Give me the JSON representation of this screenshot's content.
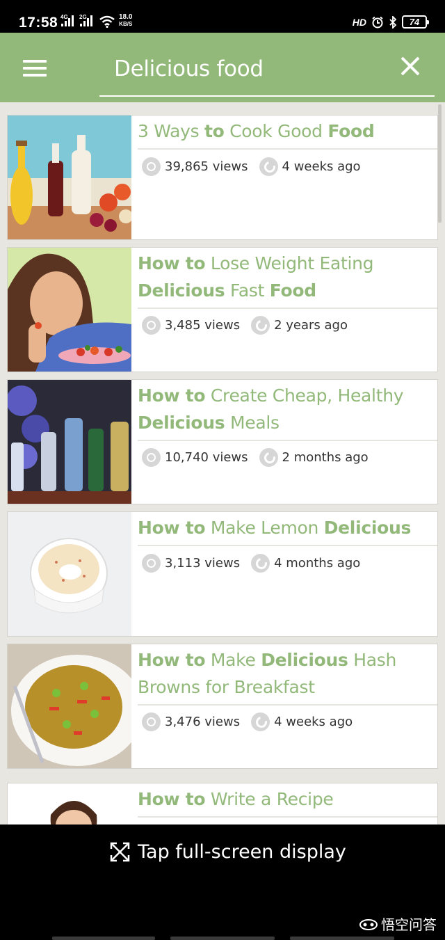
{
  "status_bar": {
    "time": "17:58",
    "network_1": "4G",
    "network_2": "2G",
    "speed_value": "18.0",
    "speed_unit": "KB/S",
    "hd_label": "HD",
    "battery": "74"
  },
  "app_bar": {
    "search_query": "Delicious food",
    "colors": {
      "bar": "#92b97a",
      "accent_text": "#92b97a"
    }
  },
  "articles": [
    {
      "title_parts": [
        {
          "t": "3 Ways ",
          "b": false
        },
        {
          "t": "to",
          "b": true
        },
        {
          "t": " Cook Good ",
          "b": false
        },
        {
          "t": "Food",
          "b": true
        }
      ],
      "views": "39,865 views",
      "age": "4 weeks ago",
      "thumbnail": "oil-and-vinegar-bottles"
    },
    {
      "title_parts": [
        {
          "t": "How to",
          "b": true
        },
        {
          "t": " Lose Weight Eating ",
          "b": false
        },
        {
          "t": "Delicious",
          "b": true
        },
        {
          "t": " Fast ",
          "b": false
        },
        {
          "t": "Food",
          "b": true
        }
      ],
      "views": "3,485 views",
      "age": "2 years ago",
      "thumbnail": "woman-eating-salad"
    },
    {
      "title_parts": [
        {
          "t": "How to",
          "b": true
        },
        {
          "t": " Create Cheap, Healthy ",
          "b": false
        },
        {
          "t": "Delicious",
          "b": true
        },
        {
          "t": " Meals",
          "b": false
        }
      ],
      "views": "10,740 views",
      "age": "2 months ago",
      "thumbnail": "liquor-bottles-shelf"
    },
    {
      "title_parts": [
        {
          "t": "How to",
          "b": true
        },
        {
          "t": " Make Lemon ",
          "b": false
        },
        {
          "t": "Delicious",
          "b": true
        }
      ],
      "views": "3,113 views",
      "age": "4 months ago",
      "thumbnail": "lemon-custard-ramekin"
    },
    {
      "title_parts": [
        {
          "t": "How to",
          "b": true
        },
        {
          "t": " Make ",
          "b": false
        },
        {
          "t": "Delicious",
          "b": true
        },
        {
          "t": " Hash Browns for Breakfast",
          "b": false
        }
      ],
      "views": "3,476 views",
      "age": "4 weeks ago",
      "thumbnail": "hash-browns-plate"
    },
    {
      "title_parts": [
        {
          "t": "How to",
          "b": true
        },
        {
          "t": " Write a Recipe",
          "b": false
        }
      ],
      "views": "",
      "age": "",
      "thumbnail": "woman-portrait"
    }
  ],
  "bottom_overlay": {
    "fullscreen_label": "Tap full-screen display",
    "brand_label": "悟空问答"
  }
}
